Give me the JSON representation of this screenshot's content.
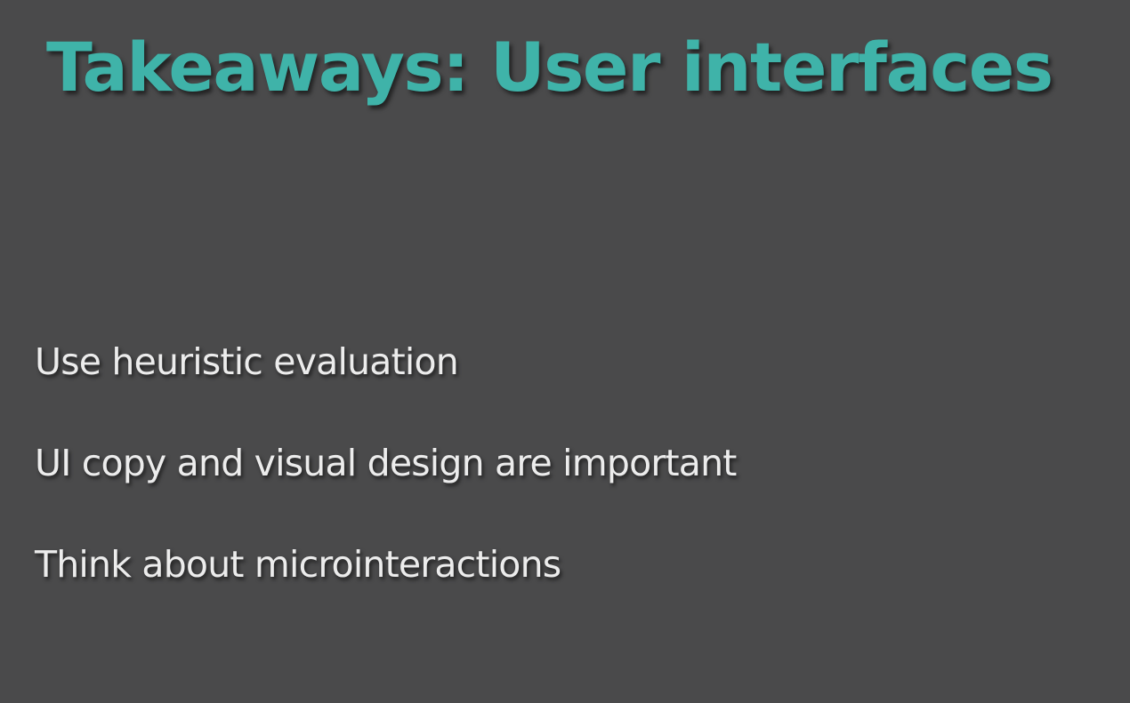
{
  "slide": {
    "title": "Takeaways: User interfaces",
    "bullets": [
      "Use heuristic evaluation",
      "UI copy and visual design are important",
      "Think about microinteractions"
    ]
  },
  "colors": {
    "background": "#4a4a4b",
    "title": "#3fb3a9",
    "body_text": "#ececec"
  }
}
